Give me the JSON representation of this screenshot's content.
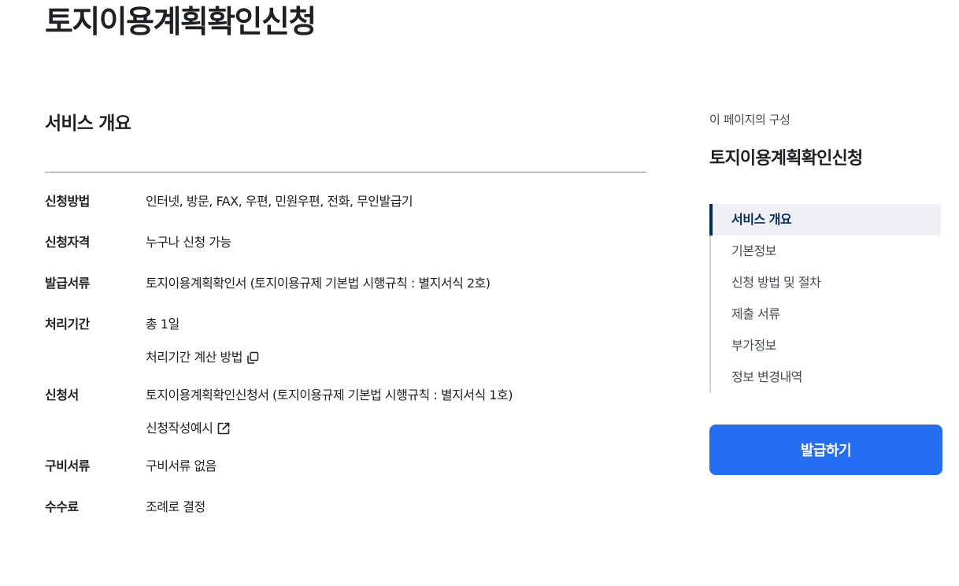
{
  "page": {
    "title": "토지이용계획확인신청"
  },
  "overview": {
    "section_title": "서비스 개요",
    "rows": [
      {
        "label": "신청방법",
        "value": "인터넷, 방문, FAX, 우편, 민원우편, 전화, 무인발급기"
      },
      {
        "label": "신청자격",
        "value": "누구나 신청 가능"
      },
      {
        "label": "발급서류",
        "value": "토지이용계획확인서 (토지이용규제 기본법 시행규칙 : 별지서식 2호)"
      },
      {
        "label": "처리기간",
        "value": "총 1일",
        "link": {
          "text": "처리기간 계산 방법",
          "icon": "copy-icon"
        }
      },
      {
        "label": "신청서",
        "value": "토지이용계획확인신청서 (토지이용규제 기본법 시행규칙 : 별지서식 1호)",
        "link": {
          "text": "신청작성예시",
          "icon": "external-link-icon"
        }
      },
      {
        "label": "구비서류",
        "value": "구비서류 없음"
      },
      {
        "label": "수수료",
        "value": "조례로 결정"
      }
    ]
  },
  "aside": {
    "kicker": "이 페이지의 구성",
    "title": "토지이용계획확인신청",
    "toc": [
      {
        "label": "서비스 개요",
        "active": true
      },
      {
        "label": "기본정보",
        "active": false
      },
      {
        "label": "신청 방법 및 절차",
        "active": false
      },
      {
        "label": "제출 서류",
        "active": false
      },
      {
        "label": "부가정보",
        "active": false
      },
      {
        "label": "정보 변경내역",
        "active": false
      }
    ],
    "issue_button": "발급하기"
  },
  "colors": {
    "primary": "#256ef4",
    "toc_active_bar": "#052b57",
    "toc_active_bg": "#eef0f4",
    "text": "#1e2124",
    "rule": "#8f9194"
  }
}
